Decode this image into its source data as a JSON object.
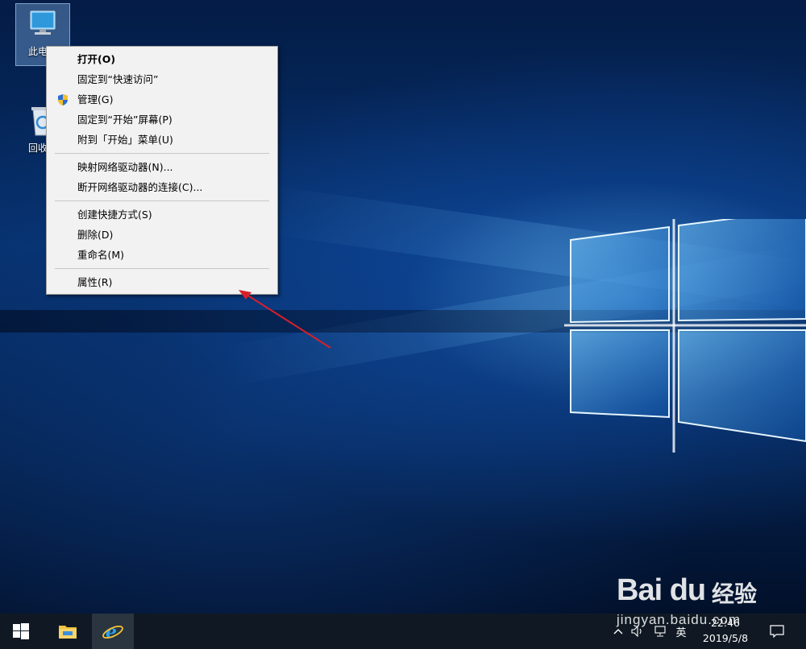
{
  "desktop": {
    "icons": [
      {
        "label": "此电脑",
        "icon": "this-pc-icon"
      },
      {
        "label": "回收站",
        "icon": "recycle-bin-icon"
      }
    ]
  },
  "context_menu": {
    "groups": [
      [
        {
          "label": "打开(O)",
          "bold": true
        },
        {
          "label": "固定到“快速访问”"
        },
        {
          "label": "管理(G)",
          "icon": "uac-shield-icon"
        },
        {
          "label": "固定到“开始”屏幕(P)"
        },
        {
          "label": "附到「开始」菜单(U)"
        }
      ],
      [
        {
          "label": "映射网络驱动器(N)..."
        },
        {
          "label": "断开网络驱动器的连接(C)..."
        }
      ],
      [
        {
          "label": "创建快捷方式(S)"
        },
        {
          "label": "删除(D)"
        },
        {
          "label": "重命名(M)"
        }
      ],
      [
        {
          "label": "属性(R)"
        }
      ]
    ]
  },
  "watermark": {
    "brand": "Bai du",
    "cn": "经验",
    "url": "jingyan.baidu.com"
  },
  "taskbar": {
    "buttons": [
      "start-icon",
      "file-explorer-icon",
      "internet-explorer-icon"
    ],
    "tray": {
      "lang": "英",
      "time": "22:46",
      "date": "2019/5/8"
    }
  },
  "colors": {
    "annotation_arrow": "#d8202a",
    "menu_bg": "#f2f2f2",
    "taskbar_bg": "#101923"
  }
}
